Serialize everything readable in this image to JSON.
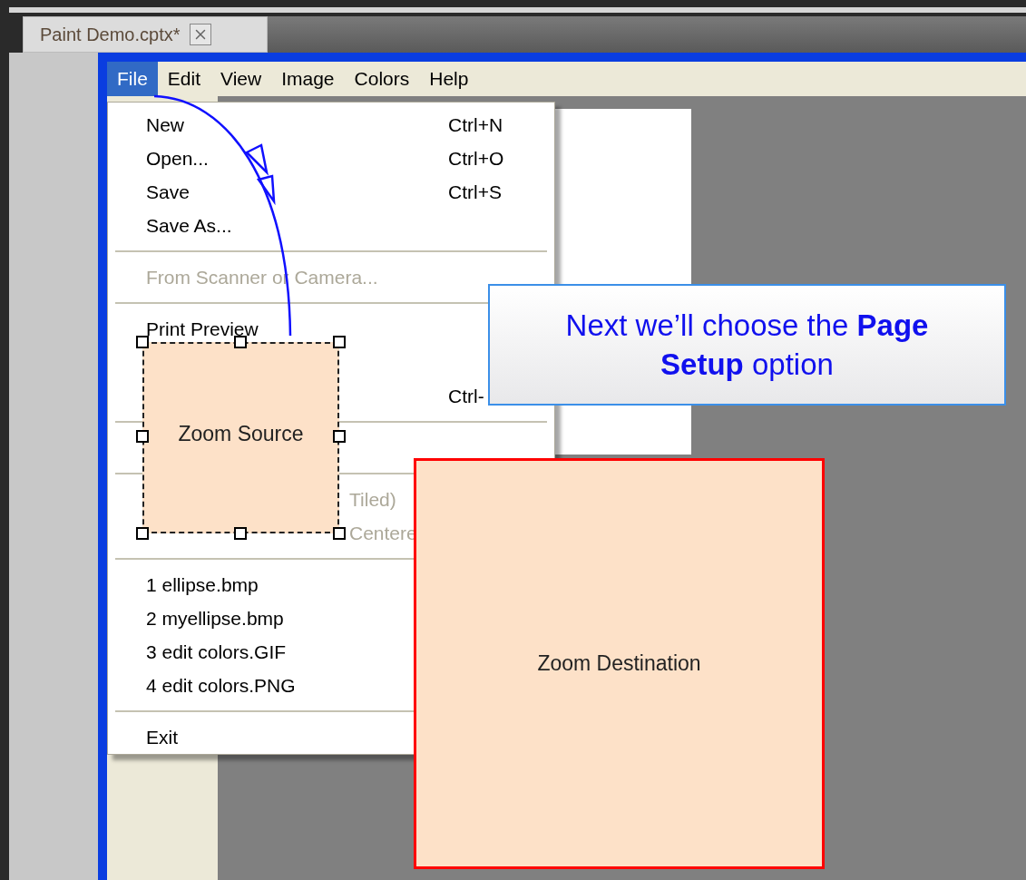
{
  "tab": {
    "title": "Paint Demo.cptx*"
  },
  "menu_bar": [
    {
      "label": "File",
      "selected": true
    },
    {
      "label": "Edit",
      "selected": false
    },
    {
      "label": "View",
      "selected": false
    },
    {
      "label": "Image",
      "selected": false
    },
    {
      "label": "Colors",
      "selected": false
    },
    {
      "label": "Help",
      "selected": false
    }
  ],
  "file_menu": {
    "items": [
      {
        "kind": "item",
        "label": "New",
        "shortcut": "Ctrl+N",
        "disabled": false
      },
      {
        "kind": "item",
        "label": "Open...",
        "shortcut": "Ctrl+O",
        "disabled": false
      },
      {
        "kind": "item",
        "label": "Save",
        "shortcut": "Ctrl+S",
        "disabled": false
      },
      {
        "kind": "item",
        "label": "Save As...",
        "disabled": false
      },
      {
        "kind": "separator"
      },
      {
        "kind": "item",
        "label": "From Scanner or Camera...",
        "disabled": true
      },
      {
        "kind": "separator"
      },
      {
        "kind": "item",
        "label": "Print Preview",
        "disabled": false
      },
      {
        "kind": "covered"
      },
      {
        "kind": "item",
        "shortcut": "Ctrl-",
        "disabled": false
      },
      {
        "kind": "separator"
      },
      {
        "kind": "covered"
      },
      {
        "kind": "separator"
      },
      {
        "kind": "partial",
        "label": "Tiled)",
        "disabled": true
      },
      {
        "kind": "partial",
        "label": "Centere",
        "disabled": true
      },
      {
        "kind": "separator"
      },
      {
        "kind": "item",
        "label": "1 ellipse.bmp",
        "disabled": false
      },
      {
        "kind": "item",
        "label": "2 myellipse.bmp",
        "disabled": false
      },
      {
        "kind": "item",
        "label": "3 edit colors.GIF",
        "disabled": false
      },
      {
        "kind": "item",
        "label": "4 edit colors.PNG",
        "disabled": false
      },
      {
        "kind": "separator"
      },
      {
        "kind": "item",
        "label": "Exit",
        "disabled": false
      }
    ]
  },
  "caption": {
    "text": "Next we’ll choose the **Page Setup** option"
  },
  "zoom_source": {
    "label": "Zoom Source"
  },
  "zoom_destination": {
    "label": "Zoom Destination"
  }
}
